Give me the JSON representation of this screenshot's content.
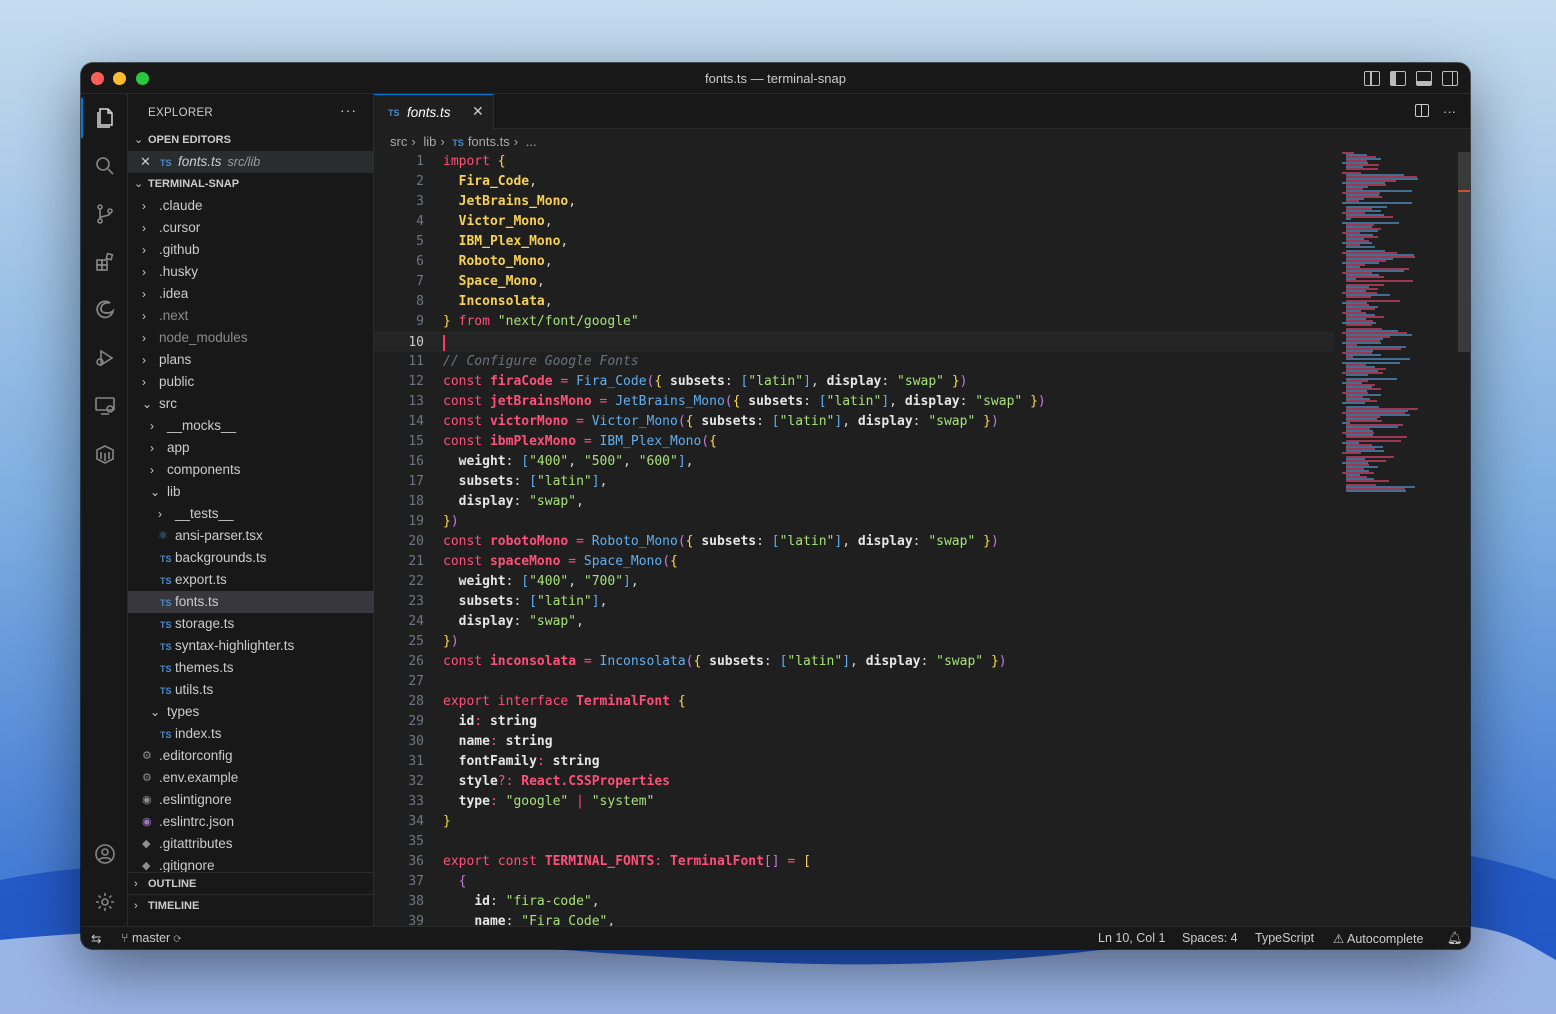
{
  "window": {
    "title": "fonts.ts — terminal-snap"
  },
  "sidebar": {
    "header": "EXPLORER",
    "more": "···",
    "open_editors": {
      "title": "OPEN EDITORS",
      "items": [
        {
          "name": "fonts.ts",
          "path": "src/lib",
          "badge": "TS"
        }
      ]
    },
    "project": {
      "title": "TERMINAL-SNAP",
      "items": [
        {
          "label": ".claude",
          "type": "folder",
          "state": "collapsed",
          "depth": 0
        },
        {
          "label": ".cursor",
          "type": "folder",
          "state": "collapsed",
          "depth": 0
        },
        {
          "label": ".github",
          "type": "folder",
          "state": "collapsed",
          "depth": 0
        },
        {
          "label": ".husky",
          "type": "folder",
          "state": "collapsed",
          "depth": 0
        },
        {
          "label": ".idea",
          "type": "folder",
          "state": "collapsed",
          "depth": 0
        },
        {
          "label": ".next",
          "type": "folder",
          "state": "collapsed",
          "depth": 0,
          "dim": true
        },
        {
          "label": "node_modules",
          "type": "folder",
          "state": "collapsed",
          "depth": 0,
          "dim": true
        },
        {
          "label": "plans",
          "type": "folder",
          "state": "collapsed",
          "depth": 0
        },
        {
          "label": "public",
          "type": "folder",
          "state": "collapsed",
          "depth": 0
        },
        {
          "label": "src",
          "type": "folder",
          "state": "expanded",
          "depth": 0
        },
        {
          "label": "__mocks__",
          "type": "folder",
          "state": "collapsed",
          "depth": 1
        },
        {
          "label": "app",
          "type": "folder",
          "state": "collapsed",
          "depth": 1
        },
        {
          "label": "components",
          "type": "folder",
          "state": "collapsed",
          "depth": 1
        },
        {
          "label": "lib",
          "type": "folder",
          "state": "expanded",
          "depth": 1
        },
        {
          "label": "__tests__",
          "type": "folder",
          "state": "collapsed",
          "depth": 2
        },
        {
          "label": "ansi-parser.tsx",
          "type": "file",
          "icon": "react-icon",
          "depth": 2
        },
        {
          "label": "backgrounds.ts",
          "type": "file",
          "icon": "TS",
          "depth": 2
        },
        {
          "label": "export.ts",
          "type": "file",
          "icon": "TS",
          "depth": 2
        },
        {
          "label": "fonts.ts",
          "type": "file",
          "icon": "TS",
          "depth": 2,
          "selected": true
        },
        {
          "label": "storage.ts",
          "type": "file",
          "icon": "TS",
          "depth": 2
        },
        {
          "label": "syntax-highlighter.ts",
          "type": "file",
          "icon": "TS",
          "depth": 2
        },
        {
          "label": "themes.ts",
          "type": "file",
          "icon": "TS",
          "depth": 2
        },
        {
          "label": "utils.ts",
          "type": "file",
          "icon": "TS",
          "depth": 2
        },
        {
          "label": "types",
          "type": "folder",
          "state": "expanded",
          "depth": 1
        },
        {
          "label": "index.ts",
          "type": "file",
          "icon": "TS",
          "depth": 2
        },
        {
          "label": ".editorconfig",
          "type": "file",
          "icon": "gear-icon",
          "depth": 0
        },
        {
          "label": ".env.example",
          "type": "file",
          "icon": "gear-icon",
          "depth": 0
        },
        {
          "label": ".eslintignore",
          "type": "file",
          "icon": "circle-icon",
          "depth": 0
        },
        {
          "label": ".eslintrc.json",
          "type": "file",
          "icon": "eslint-icon",
          "depth": 0
        },
        {
          "label": ".gitattributes",
          "type": "file",
          "icon": "git-icon",
          "depth": 0
        },
        {
          "label": ".gitignore",
          "type": "file",
          "icon": "git-icon",
          "depth": 0
        }
      ]
    },
    "outline_title": "OUTLINE",
    "timeline_title": "TIMELINE"
  },
  "editor": {
    "tab": {
      "badge": "TS",
      "label": "fonts.ts",
      "close": "✕"
    },
    "breadcrumb": [
      "src",
      "lib",
      "fonts.ts",
      "..."
    ],
    "current_line": 10,
    "lines": [
      "<span class=\"k\">import</span> <span class=\"p\">{</span>",
      "  <span class=\"id\">Fira_Code</span>,",
      "  <span class=\"id\">JetBrains_Mono</span>,",
      "  <span class=\"id\">Victor_Mono</span>,",
      "  <span class=\"id\">IBM_Plex_Mono</span>,",
      "  <span class=\"id\">Roboto_Mono</span>,",
      "  <span class=\"id\">Space_Mono</span>,",
      "  <span class=\"id\">Inconsolata</span>,",
      "<span class=\"p\">}</span> <span class=\"k\">from</span> <span class=\"s\">\"next/font/google\"</span>",
      "",
      "<span class=\"c\">// Configure Google Fonts</span>",
      "<span class=\"k\">const</span> <span class=\"v\">firaCode</span> <span class=\"k\">=</span> <span class=\"f\">Fira_Code</span><span class=\"b\">(</span><span class=\"p\">{</span> <span class=\"w\">subsets</span>: <span class=\"br\">[</span><span class=\"s\">\"latin\"</span><span class=\"br\">]</span>, <span class=\"w\">display</span>: <span class=\"s\">\"swap\"</span> <span class=\"p\">}</span><span class=\"b\">)</span>",
      "<span class=\"k\">const</span> <span class=\"v\">jetBrainsMono</span> <span class=\"k\">=</span> <span class=\"f\">JetBrains_Mono</span><span class=\"b\">(</span><span class=\"p\">{</span> <span class=\"w\">subsets</span>: <span class=\"br\">[</span><span class=\"s\">\"latin\"</span><span class=\"br\">]</span>, <span class=\"w\">display</span>: <span class=\"s\">\"swap\"</span> <span class=\"p\">}</span><span class=\"b\">)</span>",
      "<span class=\"k\">const</span> <span class=\"v\">victorMono</span> <span class=\"k\">=</span> <span class=\"f\">Victor_Mono</span><span class=\"b\">(</span><span class=\"p\">{</span> <span class=\"w\">subsets</span>: <span class=\"br\">[</span><span class=\"s\">\"latin\"</span><span class=\"br\">]</span>, <span class=\"w\">display</span>: <span class=\"s\">\"swap\"</span> <span class=\"p\">}</span><span class=\"b\">)</span>",
      "<span class=\"k\">const</span> <span class=\"v\">ibmPlexMono</span> <span class=\"k\">=</span> <span class=\"f\">IBM_Plex_Mono</span><span class=\"b\">(</span><span class=\"p\">{</span>",
      "  <span class=\"w\">weight</span>: <span class=\"br\">[</span><span class=\"s\">\"400\"</span>, <span class=\"s\">\"500\"</span>, <span class=\"s\">\"600\"</span><span class=\"br\">]</span>,",
      "  <span class=\"w\">subsets</span>: <span class=\"br\">[</span><span class=\"s\">\"latin\"</span><span class=\"br\">]</span>,",
      "  <span class=\"w\">display</span>: <span class=\"s\">\"swap\"</span>,",
      "<span class=\"p\">}</span><span class=\"b\">)</span>",
      "<span class=\"k\">const</span> <span class=\"v\">robotoMono</span> <span class=\"k\">=</span> <span class=\"f\">Roboto_Mono</span><span class=\"b\">(</span><span class=\"p\">{</span> <span class=\"w\">subsets</span>: <span class=\"br\">[</span><span class=\"s\">\"latin\"</span><span class=\"br\">]</span>, <span class=\"w\">display</span>: <span class=\"s\">\"swap\"</span> <span class=\"p\">}</span><span class=\"b\">)</span>",
      "<span class=\"k\">const</span> <span class=\"v\">spaceMono</span> <span class=\"k\">=</span> <span class=\"f\">Space_Mono</span><span class=\"b\">(</span><span class=\"p\">{</span>",
      "  <span class=\"w\">weight</span>: <span class=\"br\">[</span><span class=\"s\">\"400\"</span>, <span class=\"s\">\"700\"</span><span class=\"br\">]</span>,",
      "  <span class=\"w\">subsets</span>: <span class=\"br\">[</span><span class=\"s\">\"latin\"</span><span class=\"br\">]</span>,",
      "  <span class=\"w\">display</span>: <span class=\"s\">\"swap\"</span>,",
      "<span class=\"p\">}</span><span class=\"b\">)</span>",
      "<span class=\"k\">const</span> <span class=\"v\">inconsolata</span> <span class=\"k\">=</span> <span class=\"f\">Inconsolata</span><span class=\"b\">(</span><span class=\"p\">{</span> <span class=\"w\">subsets</span>: <span class=\"br\">[</span><span class=\"s\">\"latin\"</span><span class=\"br\">]</span>, <span class=\"w\">display</span>: <span class=\"s\">\"swap\"</span> <span class=\"p\">}</span><span class=\"b\">)</span>",
      "",
      "<span class=\"k\">export</span> <span class=\"k\">interface</span> <span class=\"ty\">TerminalFont</span> <span class=\"p\">{</span>",
      "  <span class=\"w\">id</span><span class=\"k\">:</span> <span class=\"w\">string</span>",
      "  <span class=\"w\">name</span><span class=\"k\">:</span> <span class=\"w\">string</span>",
      "  <span class=\"w\">fontFamily</span><span class=\"k\">:</span> <span class=\"w\">string</span>",
      "  <span class=\"w\">style</span><span class=\"k\">?:</span> <span class=\"ty\">React.CSSProperties</span>",
      "  <span class=\"w\">type</span><span class=\"k\">:</span> <span class=\"s\">\"google\"</span> <span class=\"k\">|</span> <span class=\"s\">\"system\"</span>",
      "<span class=\"p\">}</span>",
      "",
      "<span class=\"k\">export</span> <span class=\"k\">const</span> <span class=\"ty\">TERMINAL_FONTS</span><span class=\"k\">:</span> <span class=\"ty\">TerminalFont</span><span class=\"b\">[]</span> <span class=\"k\">=</span> <span class=\"p\">[</span>",
      "  <span class=\"b\">{</span>",
      "    <span class=\"w\">id</span>: <span class=\"s\">\"fira-code\"</span>,",
      "    <span class=\"w\">name</span>: <span class=\"s\">\"Fira Code\"</span>,"
    ]
  },
  "statusbar": {
    "remote_icon": "remote-icon",
    "branch": "master",
    "position": "Ln 10, Col 1",
    "spaces": "Spaces: 4",
    "language": "TypeScript",
    "autocomplete": "Autocomplete"
  },
  "colors": {
    "accent": "#0078d4",
    "keyword": "#ff4f7a",
    "string": "#a8e07a",
    "function": "#61afef"
  }
}
